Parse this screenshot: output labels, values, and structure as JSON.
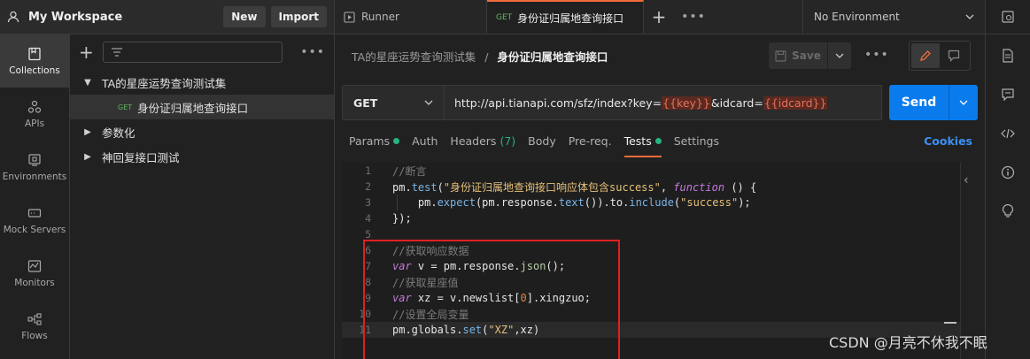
{
  "workspace": {
    "title": "My Workspace",
    "new_label": "New",
    "import_label": "Import"
  },
  "rail": {
    "items": [
      {
        "label": "Collections",
        "icon": "collections-icon"
      },
      {
        "label": "APIs",
        "icon": "apis-icon"
      },
      {
        "label": "Environments",
        "icon": "environments-icon"
      },
      {
        "label": "Mock Servers",
        "icon": "mock-servers-icon"
      },
      {
        "label": "Monitors",
        "icon": "monitors-icon"
      },
      {
        "label": "Flows",
        "icon": "flows-icon"
      }
    ]
  },
  "tree": {
    "collection": "TA的星座运势查询测试集",
    "request_method": "GET",
    "request": "身份证归属地查询接口",
    "folder1": "参数化",
    "folder2": "神回复接口测试"
  },
  "tabs": {
    "runner": "Runner",
    "active_method": "GET",
    "active_label": "身份证归属地查询接口",
    "environment": "No Environment"
  },
  "request": {
    "breadcrumb_collection": "TA的星座运势查询测试集",
    "breadcrumb_separator": "/",
    "breadcrumb_request": "身份证归属地查询接口",
    "save_label": "Save",
    "method": "GET",
    "url_prefix": "http://api.tianapi.com/sfz/index?key=",
    "url_var1": "{{key}}",
    "url_mid": "&idcard=",
    "url_var2": "{{idcard}}",
    "send_label": "Send"
  },
  "subtabs": {
    "params": "Params",
    "auth": "Auth",
    "headers": "Headers",
    "headers_count": "(7)",
    "body": "Body",
    "prereq": "Pre-req.",
    "tests": "Tests",
    "settings": "Settings",
    "cookies": "Cookies"
  },
  "editor": {
    "line_numbers": [
      "1",
      "2",
      "3",
      "4",
      "5",
      "6",
      "7",
      "8",
      "9",
      "10",
      "11"
    ],
    "l1": "//断言",
    "l2a": "pm.",
    "l2b": "test",
    "l2c": "(",
    "l2d": "\"身份证归属地查询接口响应体包含success\"",
    "l2e": ", ",
    "l2f": "function",
    "l2g": " () {",
    "l3a": "    pm.",
    "l3b": "expect",
    "l3c": "(pm.response.",
    "l3d": "text",
    "l3e": "()).to.",
    "l3f": "include",
    "l3g": "(",
    "l3h": "\"success\"",
    "l3i": ");",
    "l4": "});",
    "l5": "",
    "l6": "//获取响应数据",
    "l7a": "var",
    "l7b": " v = pm.response.",
    "l7c": "json",
    "l7d": "();",
    "l8": "//获取星座值",
    "l9a": "var",
    "l9b": " xz = v.newslist[",
    "l9c": "0",
    "l9d": "].xingzuo;",
    "l10": "//设置全局变量",
    "l11a": "pm.globals.",
    "l11b": "set",
    "l11c": "(",
    "l11d": "\"XZ\"",
    "l11e": ",xz)"
  },
  "watermark": "CSDN @月亮不休我不眠",
  "colors": {
    "accent": "#f26b3a",
    "send": "#097bed",
    "get": "#5fba5f",
    "highlight_box": "#e02020"
  }
}
